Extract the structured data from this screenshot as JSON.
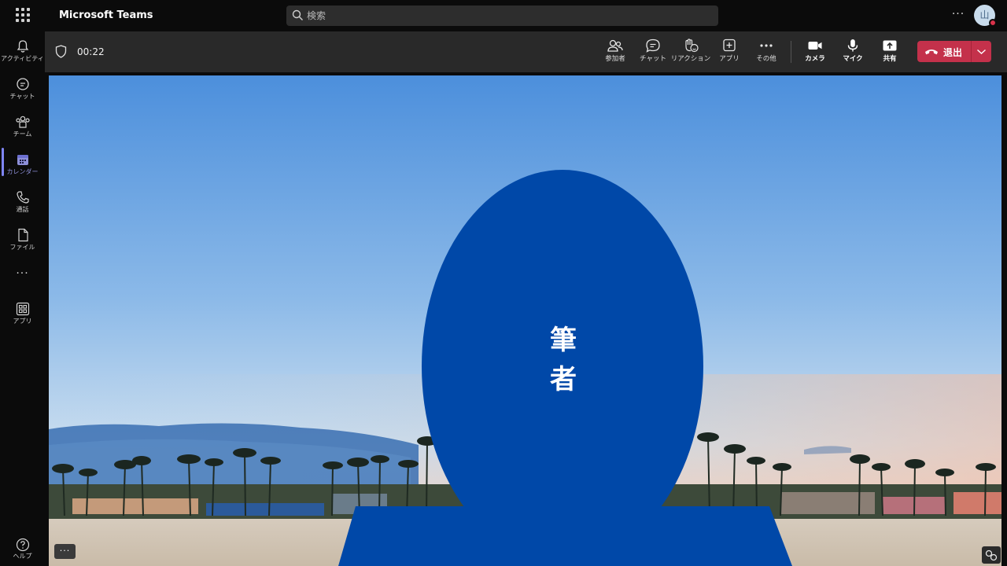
{
  "app": {
    "title": "Microsoft Teams"
  },
  "search": {
    "placeholder": "検索"
  },
  "user": {
    "avatar_initial": "山"
  },
  "top_more_label": "···",
  "rail": {
    "items": [
      {
        "label": "アクティビティ",
        "icon": "bell-icon"
      },
      {
        "label": "チャット",
        "icon": "chat-icon"
      },
      {
        "label": "チーム",
        "icon": "teams-icon"
      },
      {
        "label": "カレンダー",
        "icon": "calendar-icon",
        "active": true
      },
      {
        "label": "通話",
        "icon": "phone-icon"
      },
      {
        "label": "ファイル",
        "icon": "file-icon"
      },
      {
        "label": "アプリ",
        "icon": "apps-icon"
      }
    ],
    "more_label": "···",
    "help_label": "ヘルプ"
  },
  "call": {
    "timer": "00:22",
    "controls": [
      {
        "label": "参加者",
        "icon": "participants-icon"
      },
      {
        "label": "チャット",
        "icon": "chat-icon"
      },
      {
        "label": "リアクション",
        "icon": "reaction-icon"
      },
      {
        "label": "アプリ",
        "icon": "add-app-icon"
      },
      {
        "label": "その他",
        "icon": "more-icon"
      },
      {
        "label": "カメラ",
        "icon": "camera-icon"
      },
      {
        "label": "マイク",
        "icon": "mic-icon"
      },
      {
        "label": "共有",
        "icon": "share-icon"
      }
    ],
    "leave_label": "退出",
    "leave_color": "#c4314b"
  },
  "video": {
    "participant_name_line1": "筆",
    "participant_name_line2": "者",
    "silhouette_color": "#0048a8",
    "more_label": "···"
  }
}
